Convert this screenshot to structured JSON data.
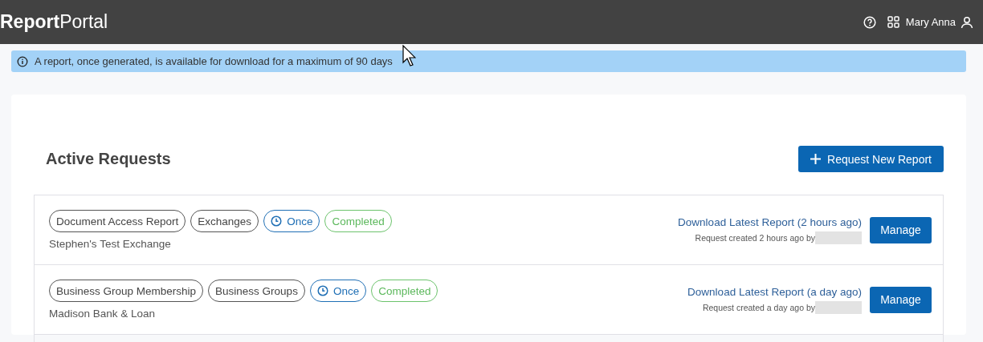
{
  "header": {
    "logo_bold": "Report",
    "logo_light": "Portal",
    "user_name": "Mary Anna"
  },
  "banner": {
    "text": "A report, once generated, is available for download for a maximum of 90 days"
  },
  "section": {
    "title": "Active Requests",
    "new_button": "Request New Report"
  },
  "requests": [
    {
      "tags": [
        {
          "kind": "type",
          "label": "Document Access Report"
        },
        {
          "kind": "type",
          "label": "Exchanges"
        },
        {
          "kind": "schedule",
          "label": "Once"
        },
        {
          "kind": "status",
          "label": "Completed"
        }
      ],
      "subtitle": "Stephen's Test Exchange",
      "download_link": "Download Latest Report (2 hours ago)",
      "created_note": "Request created 2 hours ago by",
      "manage_button": "Manage"
    },
    {
      "tags": [
        {
          "kind": "type",
          "label": "Business Group Membership"
        },
        {
          "kind": "type",
          "label": "Business Groups"
        },
        {
          "kind": "schedule",
          "label": "Once"
        },
        {
          "kind": "status",
          "label": "Completed"
        }
      ],
      "subtitle": "Madison Bank & Loan",
      "download_link": "Download Latest Report (a day ago)",
      "created_note": "Request created a day ago by",
      "manage_button": "Manage"
    }
  ]
}
